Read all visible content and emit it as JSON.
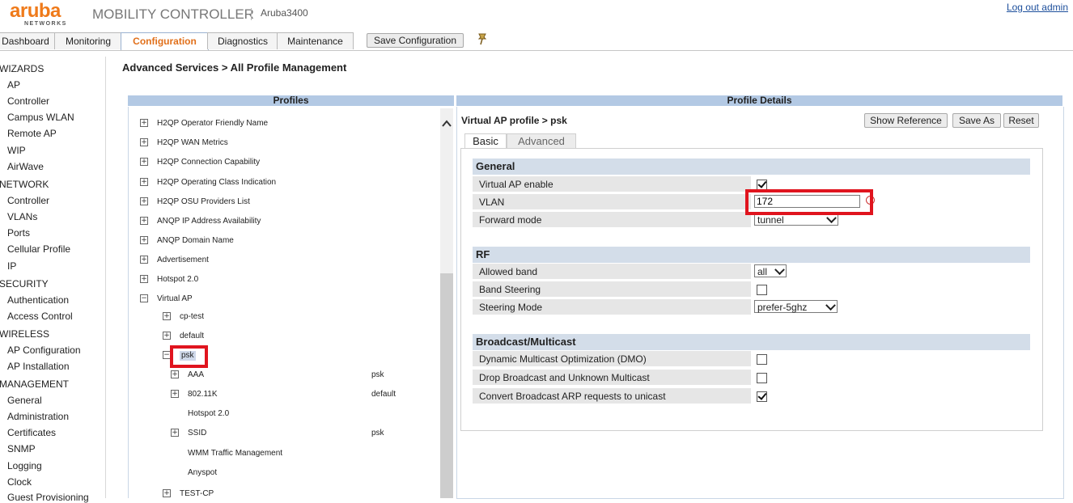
{
  "header": {
    "logo_word": "aruba",
    "logo_sub": "NETWORKS",
    "product": "MOBILITY CONTROLLER",
    "host": "Aruba3400",
    "logout": "Log out admin"
  },
  "tabs": [
    {
      "label": "Dashboard"
    },
    {
      "label": "Monitoring"
    },
    {
      "label": "Configuration"
    },
    {
      "label": "Diagnostics"
    },
    {
      "label": "Maintenance"
    }
  ],
  "save_config": "Save Configuration",
  "nav": {
    "sections": [
      {
        "label": "WIZARDS",
        "items": [
          "AP",
          "Controller",
          "Campus WLAN",
          "Remote AP",
          "WIP",
          "AirWave"
        ]
      },
      {
        "label": "NETWORK",
        "items": [
          "Controller",
          "VLANs",
          "Ports",
          "Cellular Profile",
          "IP"
        ]
      },
      {
        "label": "SECURITY",
        "items": [
          "Authentication",
          "Access Control"
        ]
      },
      {
        "label": "WIRELESS",
        "items": [
          "AP Configuration",
          "AP Installation"
        ]
      },
      {
        "label": "MANAGEMENT",
        "items": [
          "General",
          "Administration",
          "Certificates",
          "SNMP",
          "Logging",
          "Clock",
          "Guest Provisioning"
        ]
      }
    ]
  },
  "page_title": "Advanced Services > All Profile Management",
  "profiles": {
    "header": "Profiles",
    "tree": [
      {
        "label": "H2QP Operator Friendly Name",
        "exp": "+"
      },
      {
        "label": "H2QP WAN Metrics",
        "exp": "+"
      },
      {
        "label": "H2QP Connection Capability",
        "exp": "+"
      },
      {
        "label": "H2QP Operating Class Indication",
        "exp": "+"
      },
      {
        "label": "H2QP OSU Providers List",
        "exp": "+"
      },
      {
        "label": "ANQP IP Address Availability",
        "exp": "+"
      },
      {
        "label": "ANQP Domain Name",
        "exp": "+"
      },
      {
        "label": "Advertisement",
        "exp": "+"
      },
      {
        "label": "Hotspot 2.0",
        "exp": "+"
      },
      {
        "label": "Virtual AP",
        "exp": "−"
      },
      {
        "label": "cp-test",
        "exp": "+"
      },
      {
        "label": "default",
        "exp": "+"
      },
      {
        "label": "psk",
        "exp": "−"
      },
      {
        "label": "AAA",
        "exp": "+",
        "value": "psk"
      },
      {
        "label": "802.11K",
        "exp": "+",
        "value": "default"
      },
      {
        "label": "Hotspot 2.0",
        "exp": "",
        "value": ""
      },
      {
        "label": "SSID",
        "exp": "+",
        "value": "psk"
      },
      {
        "label": "WMM Traffic Management",
        "exp": "",
        "value": ""
      },
      {
        "label": "Anyspot",
        "exp": "",
        "value": ""
      },
      {
        "label": "TEST-CP",
        "exp": "+"
      }
    ]
  },
  "details": {
    "header": "Profile Details",
    "crumb": "Virtual AP profile > psk",
    "buttons": {
      "show_reference": "Show Reference",
      "save_as": "Save As",
      "reset": "Reset"
    },
    "subtabs": {
      "basic": "Basic",
      "advanced": "Advanced"
    },
    "general": {
      "title": "General",
      "virtual_ap_enable": {
        "label": "Virtual AP enable",
        "checked": true
      },
      "vlan": {
        "label": "VLAN",
        "value": "172"
      },
      "forward_mode": {
        "label": "Forward mode",
        "value": "tunnel"
      }
    },
    "rf": {
      "title": "RF",
      "allowed_band": {
        "label": "Allowed band",
        "value": "all"
      },
      "band_steering": {
        "label": "Band Steering",
        "checked": false
      },
      "steering_mode": {
        "label": "Steering Mode",
        "value": "prefer-5ghz"
      }
    },
    "broadcast": {
      "title": "Broadcast/Multicast",
      "dmo": {
        "label": "Dynamic Multicast Optimization (DMO)",
        "checked": false
      },
      "drop_bcast": {
        "label": "Drop Broadcast and Unknown Multicast",
        "checked": false
      },
      "convert_arp": {
        "label": "Convert Broadcast ARP requests to unicast",
        "checked": true
      }
    }
  },
  "colors": {
    "brand": "#ef7a1a",
    "panel_header": "#b3c9e4",
    "section_header": "#d3dde9",
    "highlight": "#e0141e"
  }
}
